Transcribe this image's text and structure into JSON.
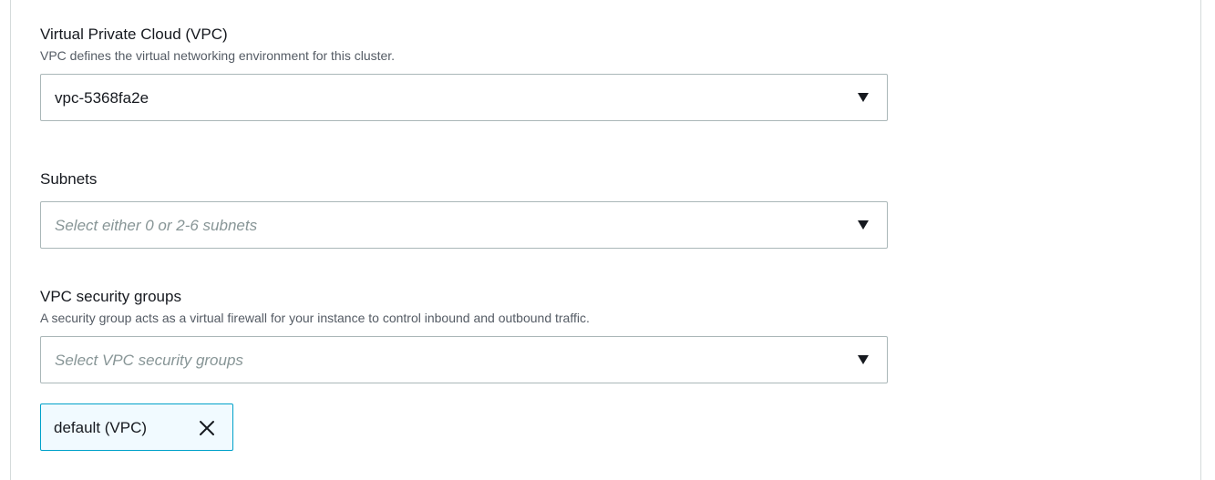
{
  "vpc": {
    "label": "Virtual Private Cloud (VPC)",
    "description": "VPC defines the virtual networking environment for this cluster.",
    "selected_value": "vpc-5368fa2e",
    "caret_icon": "caret-down-icon"
  },
  "subnets": {
    "label": "Subnets",
    "placeholder": "Select either 0 or 2-6 subnets",
    "caret_icon": "caret-down-icon"
  },
  "security_groups": {
    "label": "VPC security groups",
    "description": "A security group acts as a virtual firewall for your instance to control inbound and outbound traffic.",
    "placeholder": "Select VPC security groups",
    "caret_icon": "caret-down-icon",
    "tokens": [
      {
        "label": "default (VPC)",
        "remove_icon": "close-icon"
      }
    ]
  },
  "colors": {
    "text": "#16191f",
    "description": "#545b64",
    "placeholder": "#879596",
    "border": "#aab7b8",
    "token_border": "#00a1c9",
    "token_background": "#f1faff",
    "panel_border": "#d5dbdb"
  }
}
